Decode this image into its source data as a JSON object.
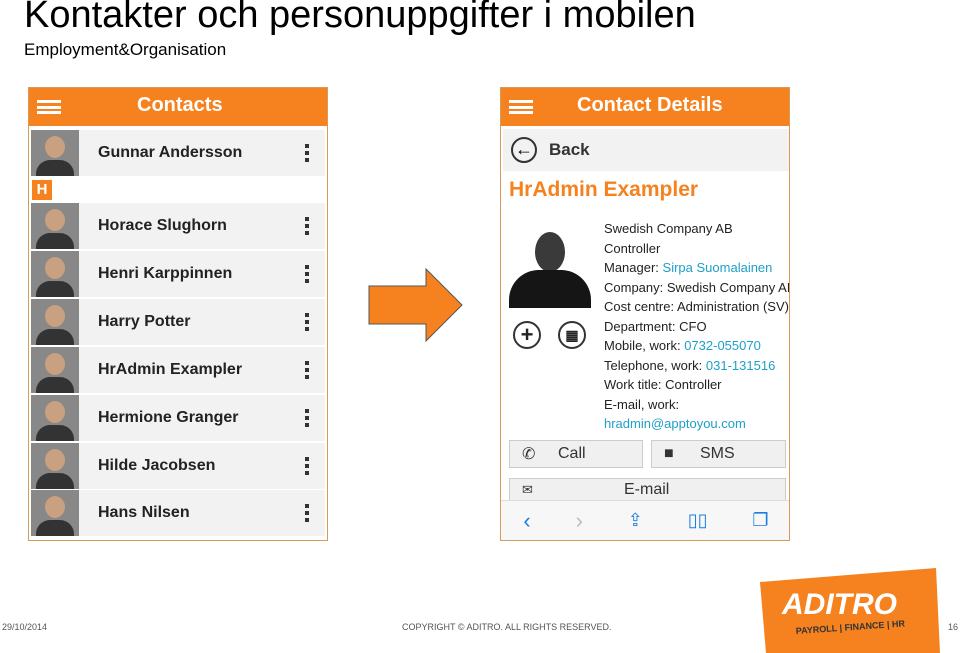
{
  "slide": {
    "title": "Kontakter och personuppgifter i mobilen",
    "subtitle": "Employment&Organisation",
    "date": "29/10/2014",
    "copyright": "COPYRIGHT © ADITRO. ALL RIGHTS RESERVED.",
    "page": "16"
  },
  "logo": {
    "name": "ADITRO",
    "tagline": "PAYROLL | FINANCE | HR",
    "color": "#f5821f"
  },
  "contacts": {
    "title": "Contacts",
    "section_letter": "H",
    "items": [
      {
        "name": "Gunnar Andersson"
      },
      {
        "name": "Horace Slughorn"
      },
      {
        "name": "Henri Karppinnen"
      },
      {
        "name": "Harry Potter"
      },
      {
        "name": "HrAdmin Exampler"
      },
      {
        "name": "Hermione Granger"
      },
      {
        "name": "Hilde Jacobsen"
      },
      {
        "name": "Hans Nilsen"
      }
    ]
  },
  "details": {
    "title": "Contact Details",
    "back": "Back",
    "name": "HrAdmin Exampler",
    "lines": [
      {
        "label": "Swedish Company AB",
        "value": ""
      },
      {
        "label": "Controller",
        "value": ""
      },
      {
        "label": "Manager: ",
        "value": "Sirpa Suomalainen",
        "link": true
      },
      {
        "label": "Company: Swedish Company AB",
        "value": ""
      },
      {
        "label": "Cost centre: Administration (SV)",
        "value": ""
      },
      {
        "label": "Department: CFO",
        "value": ""
      },
      {
        "label": "Mobile, work: ",
        "value": "0732-055070",
        "link": true
      },
      {
        "label": "Telephone, work: ",
        "value": "031-131516",
        "link": true
      },
      {
        "label": "Work title: Controller",
        "value": ""
      },
      {
        "label": "E-mail, work:",
        "value": ""
      },
      {
        "label": "",
        "value": "hradmin@apptoyou.com",
        "link": true
      }
    ],
    "call": "Call",
    "sms": "SMS",
    "email": "E-mail"
  },
  "colors": {
    "accent": "#f5821f",
    "link": "#1ea0c8"
  }
}
